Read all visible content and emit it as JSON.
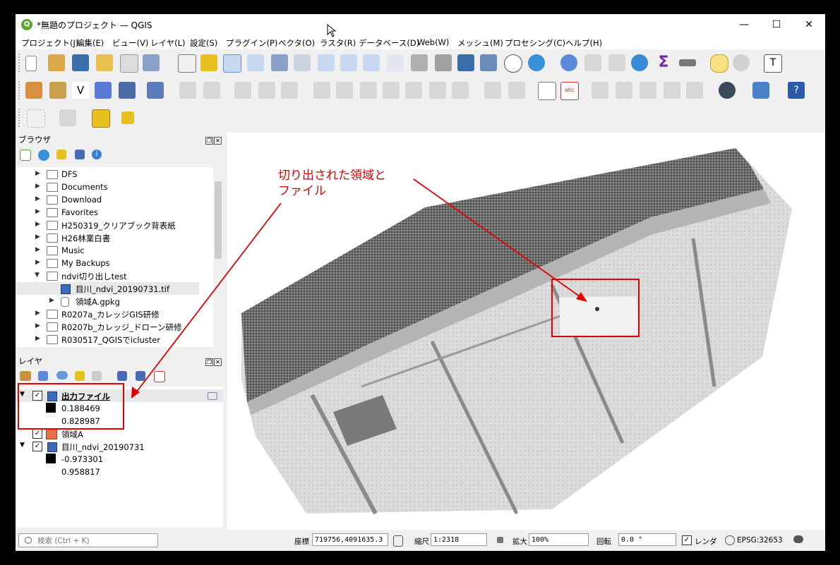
{
  "window": {
    "title": "*無題のプロジェクト — QGIS",
    "minimize": "—",
    "maximize": "☐",
    "close": "✕"
  },
  "menubar": [
    "プロジェクト(J)",
    "編集(E)",
    "ビュー(V)",
    "レイヤ(L)",
    "設定(S)",
    "プラグイン(P)",
    "ベクタ(O)",
    "ラスタ(R)",
    "データベース(D)",
    "Web(W)",
    "メッシュ(M)",
    "プロセシング(C)",
    "ヘルプ(H)"
  ],
  "browser_panel": {
    "title": "ブラウザ",
    "items": [
      {
        "label": "DFS",
        "type": "folder"
      },
      {
        "label": "Documents",
        "type": "folder"
      },
      {
        "label": "Download",
        "type": "folder"
      },
      {
        "label": "Favorites",
        "type": "folder"
      },
      {
        "label": "H250319_クリアブック背表紙",
        "type": "folder"
      },
      {
        "label": "H26林業白書",
        "type": "folder"
      },
      {
        "label": "Music",
        "type": "folder"
      },
      {
        "label": "My Backups",
        "type": "folder"
      },
      {
        "label": "ndvi切り出しtest",
        "type": "folder-open"
      },
      {
        "label": "目川_ndvi_20190731.tif",
        "type": "raster"
      },
      {
        "label": "領域A.gpkg",
        "type": "gpkg"
      },
      {
        "label": "R0207a_カレッジGIS研修",
        "type": "folder"
      },
      {
        "label": "R0207b_カレッジ_ドローン研修",
        "type": "folder"
      },
      {
        "label": "R030517_QGISでicluster",
        "type": "folder"
      }
    ]
  },
  "layers_panel": {
    "title": "レイヤ",
    "layers": [
      {
        "name": "出力ファイル",
        "checked": true,
        "min": "0.188469",
        "max": "0.828987"
      },
      {
        "name": "領域A",
        "checked": true,
        "color": "#e8704a"
      },
      {
        "name": "目川_ndvi_20190731",
        "checked": true,
        "min": "-0.973301",
        "max": "0.958817"
      }
    ]
  },
  "annotation": {
    "line1": "切り出された領域と",
    "line2": "ファイル",
    "color": "#e00000"
  },
  "statusbar": {
    "search_placeholder": "検索 (Ctrl + K)",
    "coord_label": "座標",
    "coord_value": "719756,4091635.3",
    "scale_label": "縮尺",
    "scale_value": "1:2318",
    "magnifier_label": "拡大",
    "magnifier_value": "100%",
    "rotation_label": "回転",
    "rotation_value": "0.0 °",
    "render_label": "レンダ",
    "crs": "EPSG:32653"
  }
}
